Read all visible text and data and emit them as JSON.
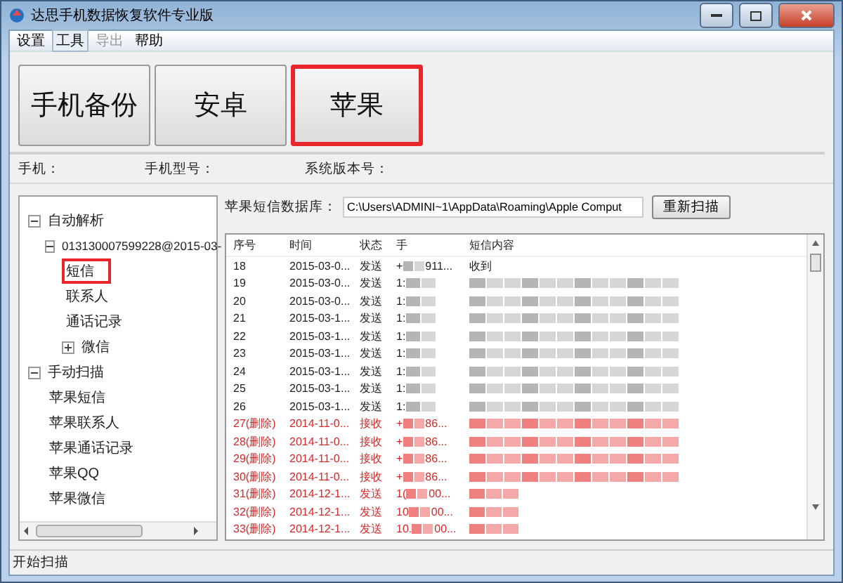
{
  "window": {
    "title": "达思手机数据恢复软件专业版"
  },
  "menu": [
    {
      "label": "设置",
      "selected": false,
      "disabled": false
    },
    {
      "label": "工具",
      "selected": true,
      "disabled": false
    },
    {
      "label": "导出",
      "selected": false,
      "disabled": true
    },
    {
      "label": "帮助",
      "selected": false,
      "disabled": false
    }
  ],
  "modes": [
    {
      "label": "手机备份",
      "selected": false
    },
    {
      "label": "安卓",
      "selected": false
    },
    {
      "label": "苹果",
      "selected": true
    }
  ],
  "info": [
    {
      "label": "手机："
    },
    {
      "label": "手机型号："
    },
    {
      "label": "系统版本号："
    }
  ],
  "tree": [
    {
      "label": "自动解析",
      "expanded": true,
      "selected": false,
      "children": [
        {
          "label": "013130007599228@2015-03-",
          "expanded": true,
          "selected": false,
          "children": [
            {
              "label": "短信",
              "selected": true
            },
            {
              "label": "联系人",
              "selected": false
            },
            {
              "label": "通话记录",
              "selected": false
            },
            {
              "label": "微信",
              "selected": false,
              "expanded": false
            }
          ]
        }
      ]
    },
    {
      "label": "手动扫描",
      "expanded": true,
      "selected": false,
      "children": [
        {
          "label": "苹果短信",
          "selected": false
        },
        {
          "label": "苹果联系人",
          "selected": false
        },
        {
          "label": "苹果通话记录",
          "selected": false
        },
        {
          "label": "苹果QQ",
          "selected": false
        },
        {
          "label": "苹果微信",
          "selected": false
        }
      ]
    }
  ],
  "database": {
    "label": "苹果短信数据库：",
    "value": "C:\\Users\\ADMINI~1\\AppData\\Roaming\\Apple Comput",
    "button": "重新扫描"
  },
  "table": {
    "columns": [
      "序号",
      "时间",
      "状态",
      "手",
      "短信内容"
    ],
    "rows": [
      {
        "no": "18",
        "time": "2015-03-0...",
        "status": "发送",
        "phone_start": "+",
        "phone_end": "911...",
        "content": "收到",
        "deleted": false
      },
      {
        "no": "19",
        "time": "2015-03-0...",
        "status": "发送",
        "phone_start": "1:",
        "deleted": false
      },
      {
        "no": "20",
        "time": "2015-03-0...",
        "status": "发送",
        "phone_start": "1:",
        "deleted": false
      },
      {
        "no": "21",
        "time": "2015-03-1...",
        "status": "发送",
        "phone_start": "1:",
        "deleted": false
      },
      {
        "no": "22",
        "time": "2015-03-1...",
        "status": "发送",
        "phone_start": "1:",
        "deleted": false
      },
      {
        "no": "23",
        "time": "2015-03-1...",
        "status": "发送",
        "phone_start": "1:",
        "deleted": false
      },
      {
        "no": "24",
        "time": "2015-03-1...",
        "status": "发送",
        "phone_start": "1:",
        "deleted": false
      },
      {
        "no": "25",
        "time": "2015-03-1...",
        "status": "发送",
        "phone_start": "1:",
        "deleted": false
      },
      {
        "no": "26",
        "time": "2015-03-1...",
        "status": "发送",
        "phone_start": "1:",
        "deleted": false
      },
      {
        "no": "27(删除)",
        "time": "2014-11-0...",
        "status": "接收",
        "phone_start": "+",
        "phone_end": "86...",
        "deleted": true
      },
      {
        "no": "28(删除)",
        "time": "2014-11-0...",
        "status": "接收",
        "phone_start": "+",
        "phone_end": "86...",
        "deleted": true
      },
      {
        "no": "29(删除)",
        "time": "2014-11-0...",
        "status": "接收",
        "phone_start": "+",
        "phone_end": "86...",
        "deleted": true
      },
      {
        "no": "30(删除)",
        "time": "2014-11-0...",
        "status": "接收",
        "phone_start": "+",
        "phone_end": "86...",
        "deleted": true
      },
      {
        "no": "31(删除)",
        "time": "2014-12-1...",
        "status": "发送",
        "phone_start": "1(",
        "phone_end": "00...",
        "deleted": true
      },
      {
        "no": "32(删除)",
        "time": "2014-12-1...",
        "status": "发送",
        "phone_start": "10",
        "phone_end": "00...",
        "deleted": true
      },
      {
        "no": "33(删除)",
        "time": "2014-12-1...",
        "status": "发送",
        "phone_start": "10.",
        "phone_end": "00...",
        "deleted": true
      }
    ]
  },
  "status_bar": {
    "text": "开始扫描"
  }
}
